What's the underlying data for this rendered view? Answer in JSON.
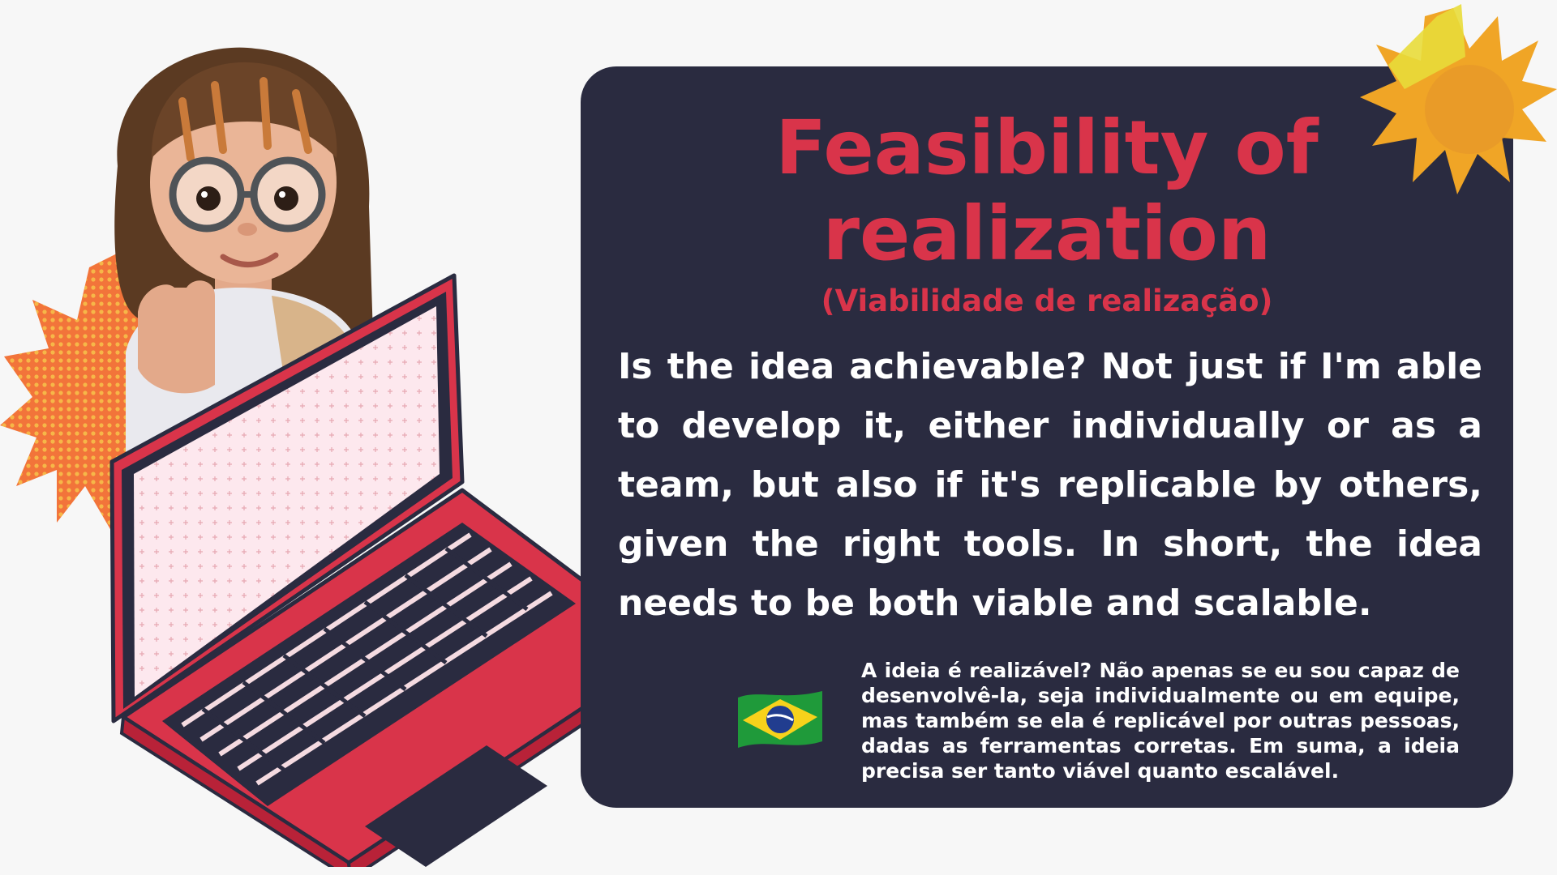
{
  "slide": {
    "title": "Feasibility of realization",
    "subtitle": "(Viabilidade de realização)",
    "body_en": "Is the idea achievable? Not just if I'm able to develop it, either individually or as a team, but also if it's replicable by others, given the right tools. In short, the idea needs to be both viable and scalable.",
    "body_pt": "A ideia é realizável? Não apenas se eu sou capaz de desenvolvê-la, seja individualmente ou em equipe, mas também se ela é replicável por outras pessoas, dadas as ferramentas corretas. Em suma, a ideia precisa ser tanto viável quanto escalável."
  },
  "icons": {
    "flag": "brazil-flag-icon",
    "sun": "sun-icon",
    "burst": "starburst-icon",
    "laptop": "laptop-icon",
    "avatar": "memoji-avatar"
  },
  "colors": {
    "card_bg": "#2a2b40",
    "title_red": "#d9344a",
    "laptop_red": "#d9344a",
    "sun_orange": "#f0a526",
    "burst_orange": "#f2743a",
    "page_bg": "#f7f7f7"
  }
}
